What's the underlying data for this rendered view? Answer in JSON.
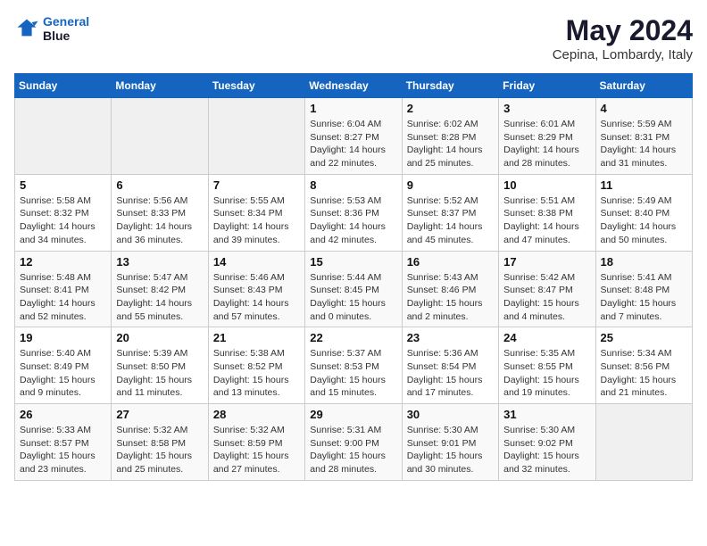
{
  "header": {
    "logo_line1": "General",
    "logo_line2": "Blue",
    "month": "May 2024",
    "location": "Cepina, Lombardy, Italy"
  },
  "days_of_week": [
    "Sunday",
    "Monday",
    "Tuesday",
    "Wednesday",
    "Thursday",
    "Friday",
    "Saturday"
  ],
  "weeks": [
    [
      {
        "day": "",
        "info": ""
      },
      {
        "day": "",
        "info": ""
      },
      {
        "day": "",
        "info": ""
      },
      {
        "day": "1",
        "info": "Sunrise: 6:04 AM\nSunset: 8:27 PM\nDaylight: 14 hours\nand 22 minutes."
      },
      {
        "day": "2",
        "info": "Sunrise: 6:02 AM\nSunset: 8:28 PM\nDaylight: 14 hours\nand 25 minutes."
      },
      {
        "day": "3",
        "info": "Sunrise: 6:01 AM\nSunset: 8:29 PM\nDaylight: 14 hours\nand 28 minutes."
      },
      {
        "day": "4",
        "info": "Sunrise: 5:59 AM\nSunset: 8:31 PM\nDaylight: 14 hours\nand 31 minutes."
      }
    ],
    [
      {
        "day": "5",
        "info": "Sunrise: 5:58 AM\nSunset: 8:32 PM\nDaylight: 14 hours\nand 34 minutes."
      },
      {
        "day": "6",
        "info": "Sunrise: 5:56 AM\nSunset: 8:33 PM\nDaylight: 14 hours\nand 36 minutes."
      },
      {
        "day": "7",
        "info": "Sunrise: 5:55 AM\nSunset: 8:34 PM\nDaylight: 14 hours\nand 39 minutes."
      },
      {
        "day": "8",
        "info": "Sunrise: 5:53 AM\nSunset: 8:36 PM\nDaylight: 14 hours\nand 42 minutes."
      },
      {
        "day": "9",
        "info": "Sunrise: 5:52 AM\nSunset: 8:37 PM\nDaylight: 14 hours\nand 45 minutes."
      },
      {
        "day": "10",
        "info": "Sunrise: 5:51 AM\nSunset: 8:38 PM\nDaylight: 14 hours\nand 47 minutes."
      },
      {
        "day": "11",
        "info": "Sunrise: 5:49 AM\nSunset: 8:40 PM\nDaylight: 14 hours\nand 50 minutes."
      }
    ],
    [
      {
        "day": "12",
        "info": "Sunrise: 5:48 AM\nSunset: 8:41 PM\nDaylight: 14 hours\nand 52 minutes."
      },
      {
        "day": "13",
        "info": "Sunrise: 5:47 AM\nSunset: 8:42 PM\nDaylight: 14 hours\nand 55 minutes."
      },
      {
        "day": "14",
        "info": "Sunrise: 5:46 AM\nSunset: 8:43 PM\nDaylight: 14 hours\nand 57 minutes."
      },
      {
        "day": "15",
        "info": "Sunrise: 5:44 AM\nSunset: 8:45 PM\nDaylight: 15 hours\nand 0 minutes."
      },
      {
        "day": "16",
        "info": "Sunrise: 5:43 AM\nSunset: 8:46 PM\nDaylight: 15 hours\nand 2 minutes."
      },
      {
        "day": "17",
        "info": "Sunrise: 5:42 AM\nSunset: 8:47 PM\nDaylight: 15 hours\nand 4 minutes."
      },
      {
        "day": "18",
        "info": "Sunrise: 5:41 AM\nSunset: 8:48 PM\nDaylight: 15 hours\nand 7 minutes."
      }
    ],
    [
      {
        "day": "19",
        "info": "Sunrise: 5:40 AM\nSunset: 8:49 PM\nDaylight: 15 hours\nand 9 minutes."
      },
      {
        "day": "20",
        "info": "Sunrise: 5:39 AM\nSunset: 8:50 PM\nDaylight: 15 hours\nand 11 minutes."
      },
      {
        "day": "21",
        "info": "Sunrise: 5:38 AM\nSunset: 8:52 PM\nDaylight: 15 hours\nand 13 minutes."
      },
      {
        "day": "22",
        "info": "Sunrise: 5:37 AM\nSunset: 8:53 PM\nDaylight: 15 hours\nand 15 minutes."
      },
      {
        "day": "23",
        "info": "Sunrise: 5:36 AM\nSunset: 8:54 PM\nDaylight: 15 hours\nand 17 minutes."
      },
      {
        "day": "24",
        "info": "Sunrise: 5:35 AM\nSunset: 8:55 PM\nDaylight: 15 hours\nand 19 minutes."
      },
      {
        "day": "25",
        "info": "Sunrise: 5:34 AM\nSunset: 8:56 PM\nDaylight: 15 hours\nand 21 minutes."
      }
    ],
    [
      {
        "day": "26",
        "info": "Sunrise: 5:33 AM\nSunset: 8:57 PM\nDaylight: 15 hours\nand 23 minutes."
      },
      {
        "day": "27",
        "info": "Sunrise: 5:32 AM\nSunset: 8:58 PM\nDaylight: 15 hours\nand 25 minutes."
      },
      {
        "day": "28",
        "info": "Sunrise: 5:32 AM\nSunset: 8:59 PM\nDaylight: 15 hours\nand 27 minutes."
      },
      {
        "day": "29",
        "info": "Sunrise: 5:31 AM\nSunset: 9:00 PM\nDaylight: 15 hours\nand 28 minutes."
      },
      {
        "day": "30",
        "info": "Sunrise: 5:30 AM\nSunset: 9:01 PM\nDaylight: 15 hours\nand 30 minutes."
      },
      {
        "day": "31",
        "info": "Sunrise: 5:30 AM\nSunset: 9:02 PM\nDaylight: 15 hours\nand 32 minutes."
      },
      {
        "day": "",
        "info": ""
      }
    ]
  ]
}
